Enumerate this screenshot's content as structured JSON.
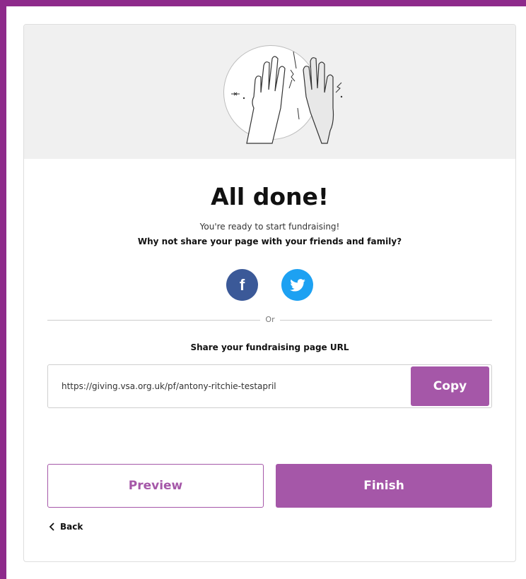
{
  "page": {
    "title": "All done!",
    "subtitle": "You're ready to start fundraising!",
    "share_prompt": "Why not share your page with your friends and family?"
  },
  "share": {
    "facebook_icon": "facebook-icon",
    "twitter_icon": "twitter-icon",
    "divider_label": "Or",
    "url_heading": "Share your fundraising page URL",
    "url_value": "https://giving.vsa.org.uk/pf/antony-ritchie-testapril",
    "copy_label": "Copy"
  },
  "actions": {
    "preview_label": "Preview",
    "finish_label": "Finish",
    "back_label": "Back"
  },
  "colors": {
    "frame": "#8e2a8b",
    "accent": "#a557a8",
    "facebook": "#3b5998",
    "twitter": "#1da1f2"
  }
}
